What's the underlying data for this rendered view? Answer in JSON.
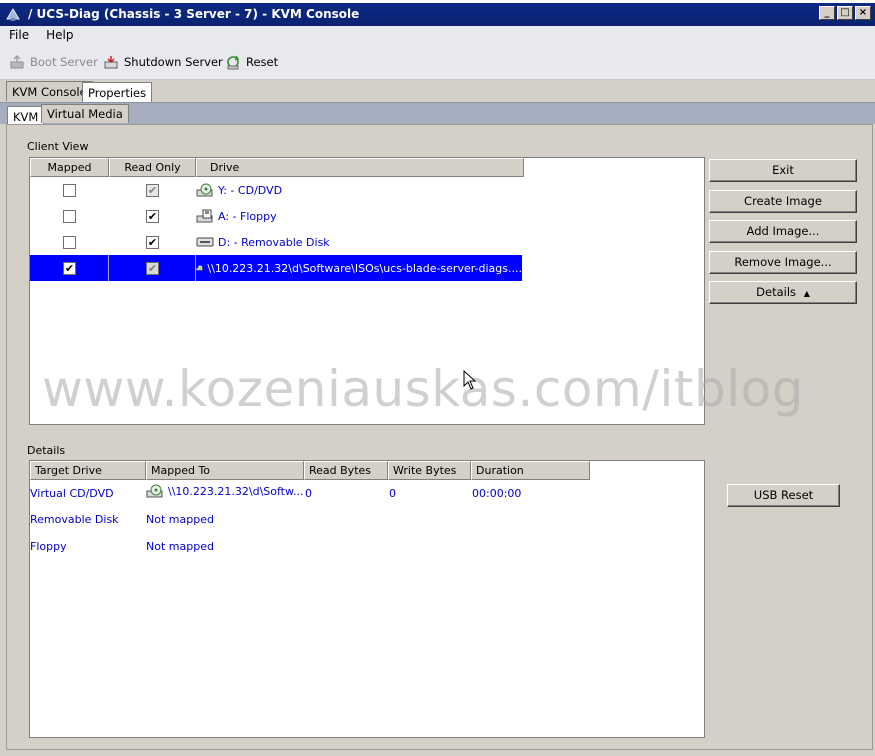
{
  "window": {
    "title": "/ UCS-Diag (Chassis - 3 Server - 7) - KVM Console",
    "controls": [
      "_",
      "□",
      "×"
    ]
  },
  "menu": [
    "File",
    "Help"
  ],
  "toolbar": {
    "boot": "Boot Server",
    "shutdown": "Shutdown Server",
    "reset": "Reset"
  },
  "tabs": {
    "outer": [
      "KVM Console",
      "Properties"
    ],
    "inner": [
      "KVM",
      "Virtual Media"
    ]
  },
  "client_view": {
    "label": "Client View",
    "columns": [
      "Mapped",
      "Read Only",
      "Drive"
    ],
    "rows": [
      {
        "mapped": false,
        "read_only": true,
        "read_only_disabled": true,
        "icon": "cd-dvd-icon",
        "drive": "Y: - CD/DVD",
        "selected": false
      },
      {
        "mapped": false,
        "read_only": true,
        "read_only_disabled": false,
        "icon": "floppy-icon",
        "drive": "A: - Floppy",
        "selected": false
      },
      {
        "mapped": false,
        "read_only": true,
        "read_only_disabled": false,
        "icon": "removable-disk-icon",
        "drive": "D: - Removable Disk",
        "selected": false
      },
      {
        "mapped": true,
        "read_only": true,
        "read_only_disabled": true,
        "icon": "iso-image-icon",
        "drive": "\\\\10.223.21.32\\d\\Software\\ISOs\\ucs-blade-server-diags....",
        "selected": true
      }
    ]
  },
  "buttons": {
    "exit": "Exit",
    "create_image": "Create Image",
    "add_image": "Add Image...",
    "remove_image": "Remove Image...",
    "details": "Details",
    "details_arrow": "▲",
    "usb_reset": "USB Reset"
  },
  "details": {
    "label": "Details",
    "columns": [
      "Target Drive",
      "Mapped To",
      "Read Bytes",
      "Write Bytes",
      "Duration"
    ],
    "rows": [
      {
        "target": "Virtual CD/DVD",
        "mapped_to": "\\\\10.223.21.32\\d\\Softw...",
        "read": "0",
        "write": "0",
        "duration": "00:00:00"
      },
      {
        "target": "Removable Disk",
        "mapped_to": "Not mapped",
        "read": "",
        "write": "",
        "duration": ""
      },
      {
        "target": "Floppy",
        "mapped_to": "Not mapped",
        "read": "",
        "write": "",
        "duration": ""
      }
    ]
  },
  "watermark": "www.kozeniauskas.com/itblog",
  "colors": {
    "title_bar": "#0d2a86",
    "selection": "#0000ff",
    "link_text": "#0000cc",
    "panel": "#d4d0c8"
  }
}
